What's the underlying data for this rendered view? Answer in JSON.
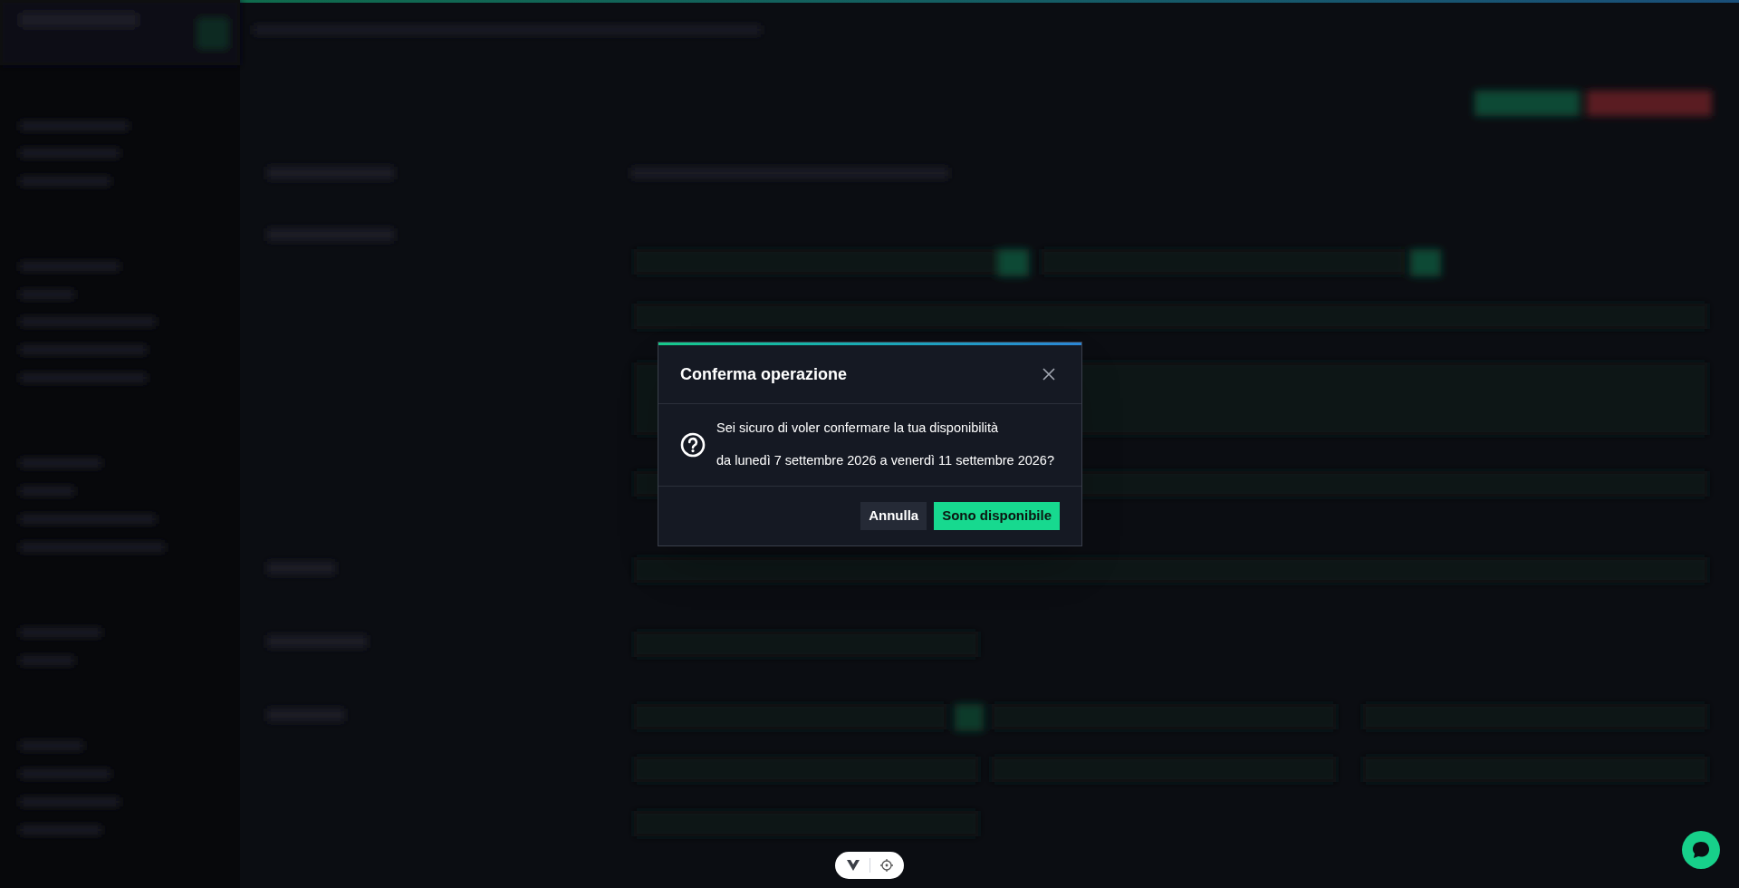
{
  "dialog": {
    "title": "Conferma operazione",
    "message_lines": [
      "Sei sicuro di voler confermare la tua disponibilità",
      "da lunedì 7 settembre 2026 a venerdì 11 settembre 2026?"
    ],
    "buttons": [
      {
        "label": "Annulla",
        "kind": "secondary"
      },
      {
        "label": "Sono disponibile",
        "kind": "primary"
      }
    ]
  }
}
